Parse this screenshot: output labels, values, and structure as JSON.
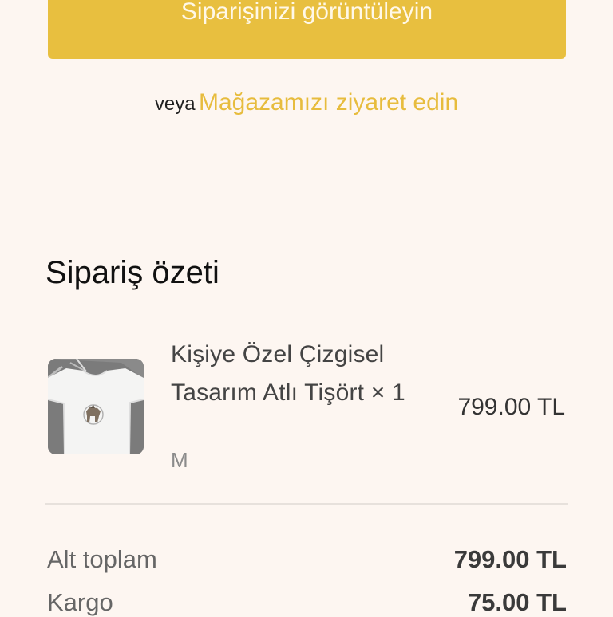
{
  "actions": {
    "view_order_label": "Siparişinizi görüntüleyin",
    "or_text": "veya",
    "store_link": "Mağazamızı ziyaret edin"
  },
  "summary": {
    "title": "Sipariş özeti",
    "items": [
      {
        "name": "Kişiye Özel Çizgisel Tasarım Atlı Tişört × 1",
        "variant": "M",
        "price": "799.00 TL"
      }
    ],
    "subtotal_label": "Alt toplam",
    "subtotal_value": "799.00 TL",
    "shipping_label": "Kargo",
    "shipping_value": "75.00 TL"
  },
  "colors": {
    "background": "#fdf6f1",
    "accent": "#e8bf3f",
    "link": "#e7bc3d"
  },
  "icons": {
    "product_image": "tshirt-thumbnail"
  }
}
